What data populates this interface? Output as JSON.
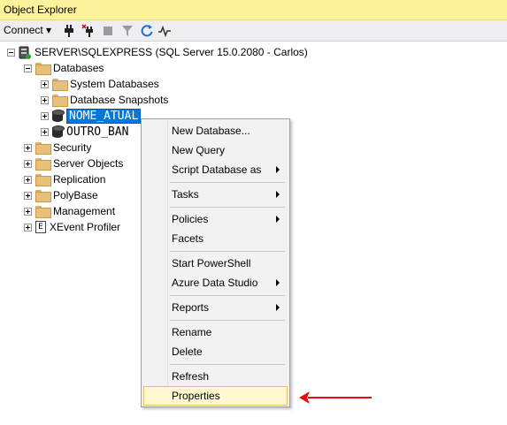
{
  "window": {
    "title": "Object Explorer"
  },
  "toolbar": {
    "connect_label": "Connect ▾"
  },
  "tree": {
    "server": "SERVER\\SQLEXPRESS (SQL Server 15.0.2080 - Carlos)",
    "databases": "Databases",
    "system_databases": "System Databases",
    "database_snapshots": "Database Snapshots",
    "db1": "NOME_ATUAL",
    "db2": "OUTRO_BAN",
    "security": "Security",
    "server_objects": "Server Objects",
    "replication": "Replication",
    "polybase": "PolyBase",
    "management": "Management",
    "xevent_profiler": "XEvent Profiler"
  },
  "context_menu": {
    "new_database": "New Database...",
    "new_query": "New Query",
    "script_database_as": "Script Database as",
    "tasks": "Tasks",
    "policies": "Policies",
    "facets": "Facets",
    "start_powershell": "Start PowerShell",
    "azure_data_studio": "Azure Data Studio",
    "reports": "Reports",
    "rename": "Rename",
    "delete": "Delete",
    "refresh": "Refresh",
    "properties": "Properties"
  },
  "colors": {
    "title_bg": "#fff29d",
    "selection": "#0078d7",
    "highlight": "#fff8d3",
    "annotation_arrow": "#e01010"
  }
}
